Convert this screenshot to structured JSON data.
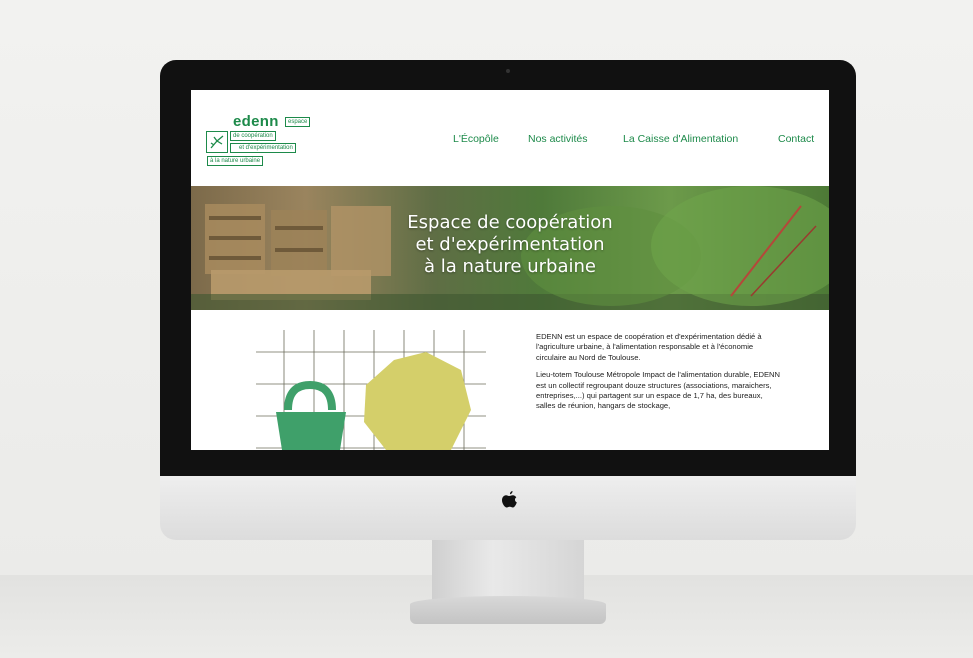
{
  "site": {
    "logo": {
      "brand": "edenn",
      "line1": "espace",
      "line2": "de coopération",
      "line3": "et d'expérimentation",
      "line4": "à la nature urbaine"
    },
    "nav": {
      "items": [
        {
          "label": "L'Écopôle"
        },
        {
          "label": "Nos activités"
        },
        {
          "label": "La Caisse d'Alimentation"
        },
        {
          "label": "Contact"
        }
      ]
    },
    "hero": {
      "line1": "Espace de coopération",
      "line2": "et d'expérimentation",
      "line3": "à la nature urbaine"
    },
    "content": {
      "para1": "EDENN est un espace de coopération et d'expérimentation dédié à l'agriculture urbaine, à l'alimentation responsable et à l'économie circulaire au Nord de Toulouse.",
      "para2": "Lieu-totem Toulouse Métropole Impact de l'alimentation durable, EDENN est un collectif regroupant douze structures (associations, maraichers, entreprises,...) qui partagent sur un espace de 1,7 ha, des bureaux, salles de réunion, hangars de stockage,"
    }
  },
  "colors": {
    "brand_green": "#1d8a4a",
    "illustration_green": "#3fa06a",
    "illustration_yellow": "#d4cf6a"
  }
}
